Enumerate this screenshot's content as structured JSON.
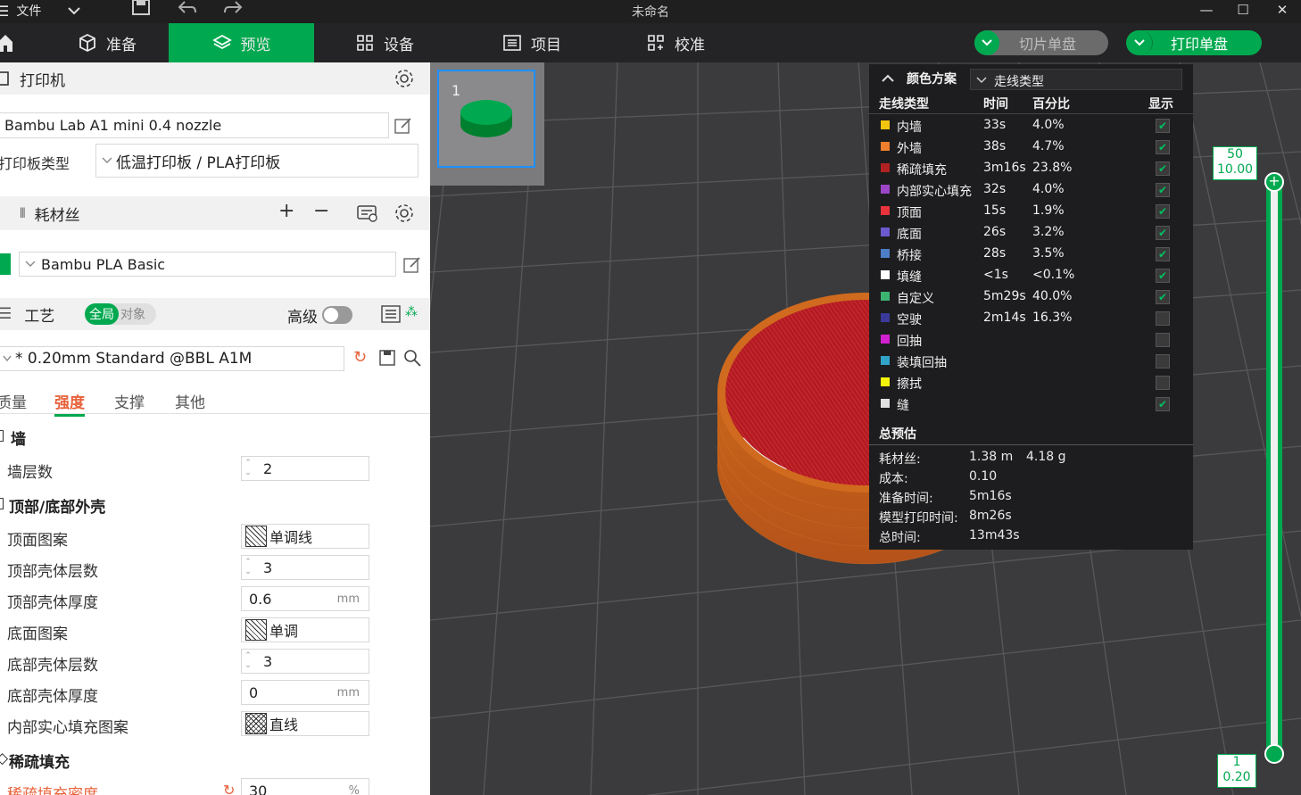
{
  "window": {
    "title": "未命名",
    "file_menu": "文件"
  },
  "toolbar": {
    "tabs": [
      {
        "label": "准备"
      },
      {
        "label": "预览"
      },
      {
        "label": "设备"
      },
      {
        "label": "项目"
      },
      {
        "label": "校准"
      }
    ],
    "slice_plate": "切片单盘",
    "print_plate": "打印单盘",
    "accent": "#00a94f"
  },
  "printer": {
    "section_title": "打印机",
    "name": "Bambu Lab A1 mini 0.4 nozzle",
    "plate_type_label": "打印板类型",
    "plate_type_value": "低温打印板 / PLA打印板"
  },
  "filament": {
    "section_title": "耗材丝",
    "name": "Bambu PLA Basic"
  },
  "process": {
    "section_title": "工艺",
    "toggle_global": "全局",
    "toggle_object": "对象",
    "advanced_label": "高级",
    "profile": "* 0.20mm Standard @BBL A1M",
    "subtabs": [
      "质量",
      "强度",
      "支撑",
      "其他"
    ],
    "active_subtab": "强度"
  },
  "settings": {
    "wall_group": "墙",
    "wall_loops_label": "墙层数",
    "wall_loops_value": "2",
    "shell_group": "顶部/底部外壳",
    "top_pattern_label": "顶面图案",
    "top_pattern_value": "单调线",
    "top_layers_label": "顶部壳体层数",
    "top_layers_value": "3",
    "top_thickness_label": "顶部壳体厚度",
    "top_thickness_value": "0.6",
    "bottom_pattern_label": "底面图案",
    "bottom_pattern_value": "单调",
    "bottom_layers_label": "底部壳体层数",
    "bottom_layers_value": "3",
    "bottom_thickness_label": "底部壳体厚度",
    "bottom_thickness_value": "0",
    "internal_solid_label": "内部实心填充图案",
    "internal_solid_value": "直线",
    "infill_group": "稀疏填充",
    "infill_density_label": "稀疏填充密度",
    "infill_density_value": "30",
    "unit_mm": "mm",
    "unit_pct": "%"
  },
  "plate_thumb": {
    "number": "1"
  },
  "legend": {
    "title": "颜色方案",
    "scheme": "走线类型",
    "headers": {
      "type": "走线类型",
      "time": "时间",
      "percent": "百分比",
      "display": "显示"
    },
    "rows": [
      {
        "name": "内墙",
        "time": "33s",
        "percent": "4.0%",
        "color": "#f2c511",
        "shown": true
      },
      {
        "name": "外墙",
        "time": "38s",
        "percent": "4.7%",
        "color": "#ef7f2c",
        "shown": true
      },
      {
        "name": "稀疏填充",
        "time": "3m16s",
        "percent": "23.8%",
        "color": "#b22222",
        "shown": true
      },
      {
        "name": "内部实心填充",
        "time": "32s",
        "percent": "4.0%",
        "color": "#9b45c8",
        "shown": true
      },
      {
        "name": "顶面",
        "time": "15s",
        "percent": "1.9%",
        "color": "#e8323c",
        "shown": true
      },
      {
        "name": "底面",
        "time": "26s",
        "percent": "3.2%",
        "color": "#6a5acd",
        "shown": true
      },
      {
        "name": "桥接",
        "time": "28s",
        "percent": "3.5%",
        "color": "#4d7fc6",
        "shown": true
      },
      {
        "name": "填缝",
        "time": "<1s",
        "percent": "<0.1%",
        "color": "#ffffff",
        "shown": true
      },
      {
        "name": "自定义",
        "time": "5m29s",
        "percent": "40.0%",
        "color": "#3cb371",
        "shown": true
      },
      {
        "name": "空驶",
        "time": "2m14s",
        "percent": "16.3%",
        "color": "#3a3a9a",
        "shown": false
      },
      {
        "name": "回抽",
        "time": "",
        "percent": "",
        "color": "#d020d0",
        "shown": false
      },
      {
        "name": "装填回抽",
        "time": "",
        "percent": "",
        "color": "#31a3c9",
        "shown": false
      },
      {
        "name": "擦拭",
        "time": "",
        "percent": "",
        "color": "#f5f50a",
        "shown": false
      },
      {
        "name": "缝",
        "time": "",
        "percent": "",
        "color": "#e0e0e0",
        "shown": true
      }
    ],
    "summary_title": "总预估",
    "filament_label": "耗材丝:",
    "filament_length": "1.38 m",
    "filament_weight": "4.18 g",
    "cost_label": "成本:",
    "cost_value": "0.10",
    "prep_label": "准备时间:",
    "prep_value": "5m16s",
    "model_label": "模型打印时间:",
    "model_value": "8m26s",
    "total_label": "总时间:",
    "total_value": "13m43s"
  },
  "layer_slider": {
    "top_layer": "50",
    "top_height": "10.00",
    "bottom_layer": "1",
    "bottom_height": "0.20"
  }
}
